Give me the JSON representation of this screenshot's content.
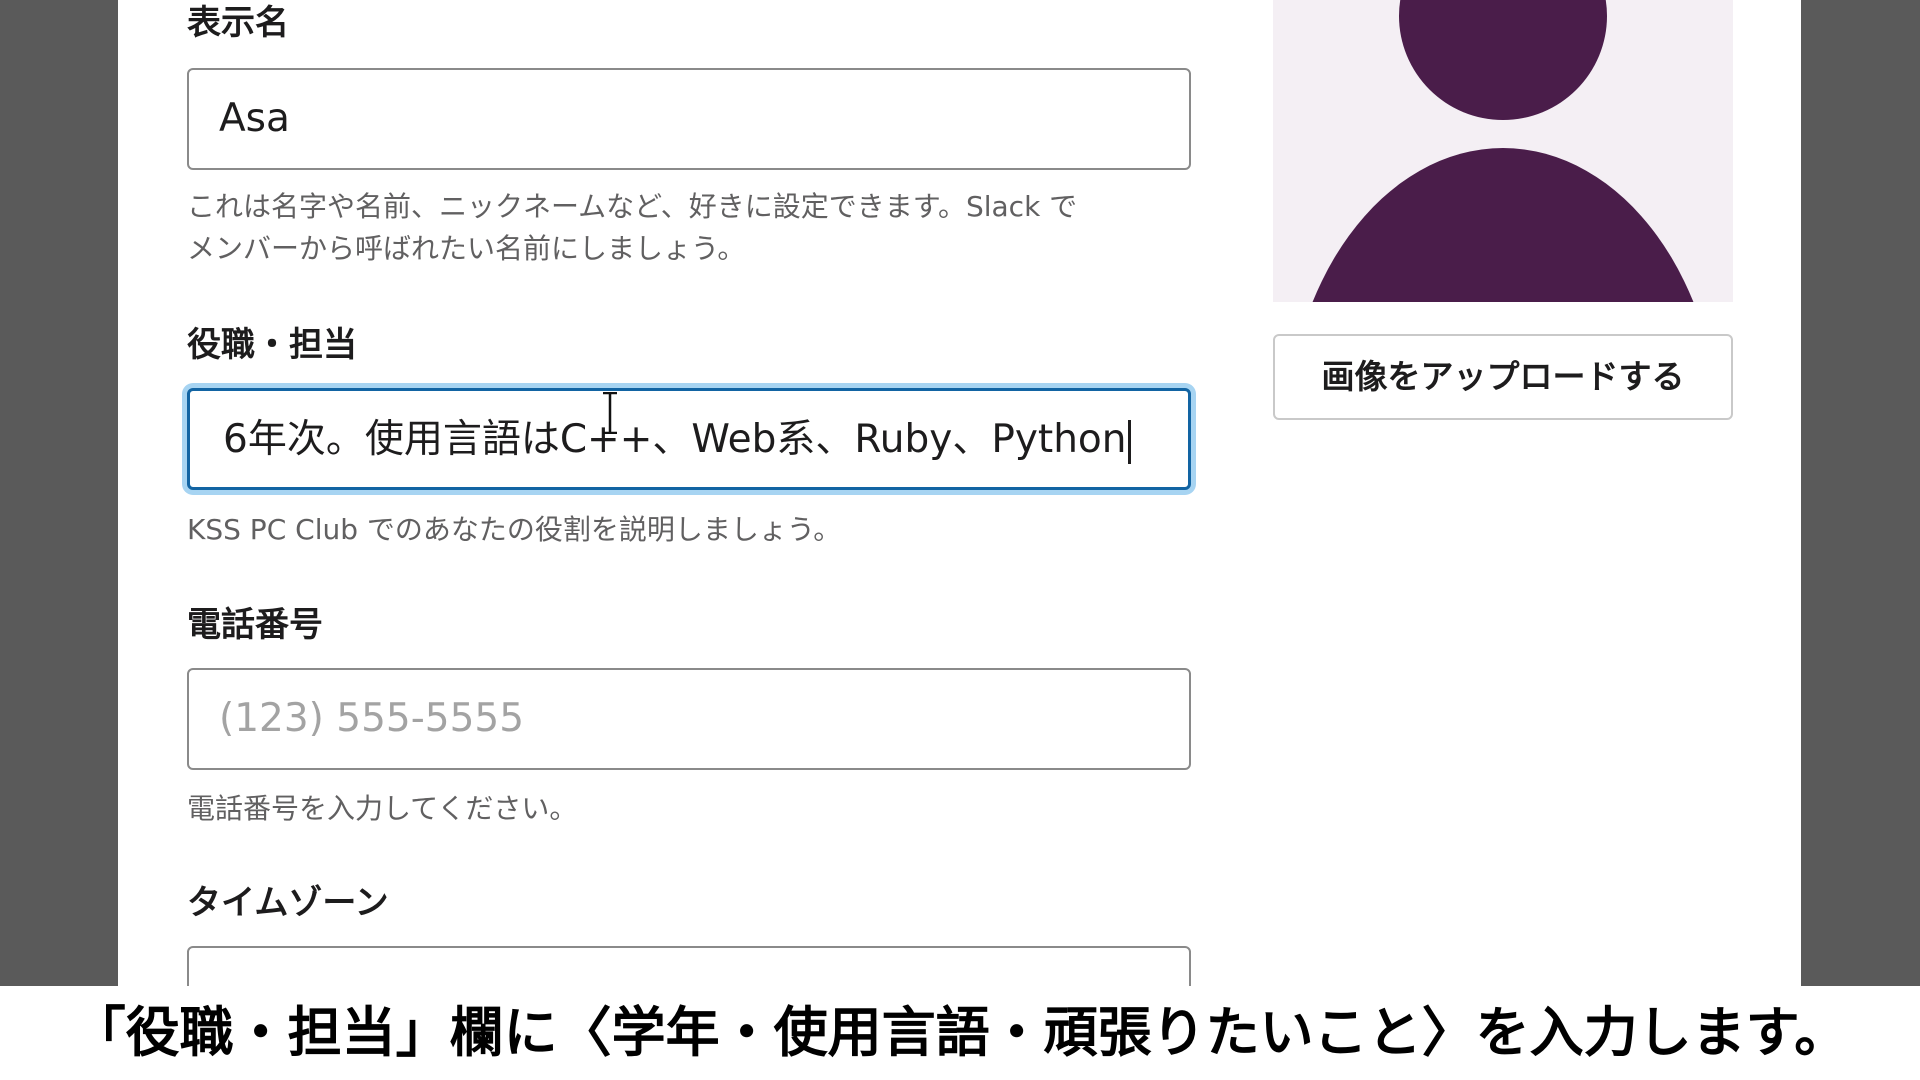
{
  "form": {
    "display_name": {
      "label": "表示名",
      "value": "Asa",
      "hint_line1": "これは名字や名前、ニックネームなど、好きに設定できます。Slack で",
      "hint_line2": "メンバーから呼ばれたい名前にしましょう。"
    },
    "role": {
      "label": "役職・担当",
      "value": "6年次。使用言語はC++、Web系、Ruby、Python",
      "hint": "KSS PC Club でのあなたの役割を説明しましょう。"
    },
    "phone": {
      "label": "電話番号",
      "placeholder": "(123) 555-5555",
      "hint": "電話番号を入力してください。"
    },
    "timezone": {
      "label": "タイムゾーン"
    }
  },
  "profile_photo": {
    "upload_label": "画像をアップロードする"
  },
  "caption": "「役職・担当」欄に〈学年・使用言語・頑張りたいこと〉を入力します。",
  "colors": {
    "focus_border": "#1264a3",
    "focus_ring": "#a7d4f2",
    "avatar_fg": "#4a1d4a",
    "avatar_bg": "#f4eff4",
    "backdrop": "#5a5a5a"
  },
  "icons": {
    "text_cursor": "i-beam-cursor-icon",
    "avatar_placeholder": "user-silhouette-icon"
  }
}
